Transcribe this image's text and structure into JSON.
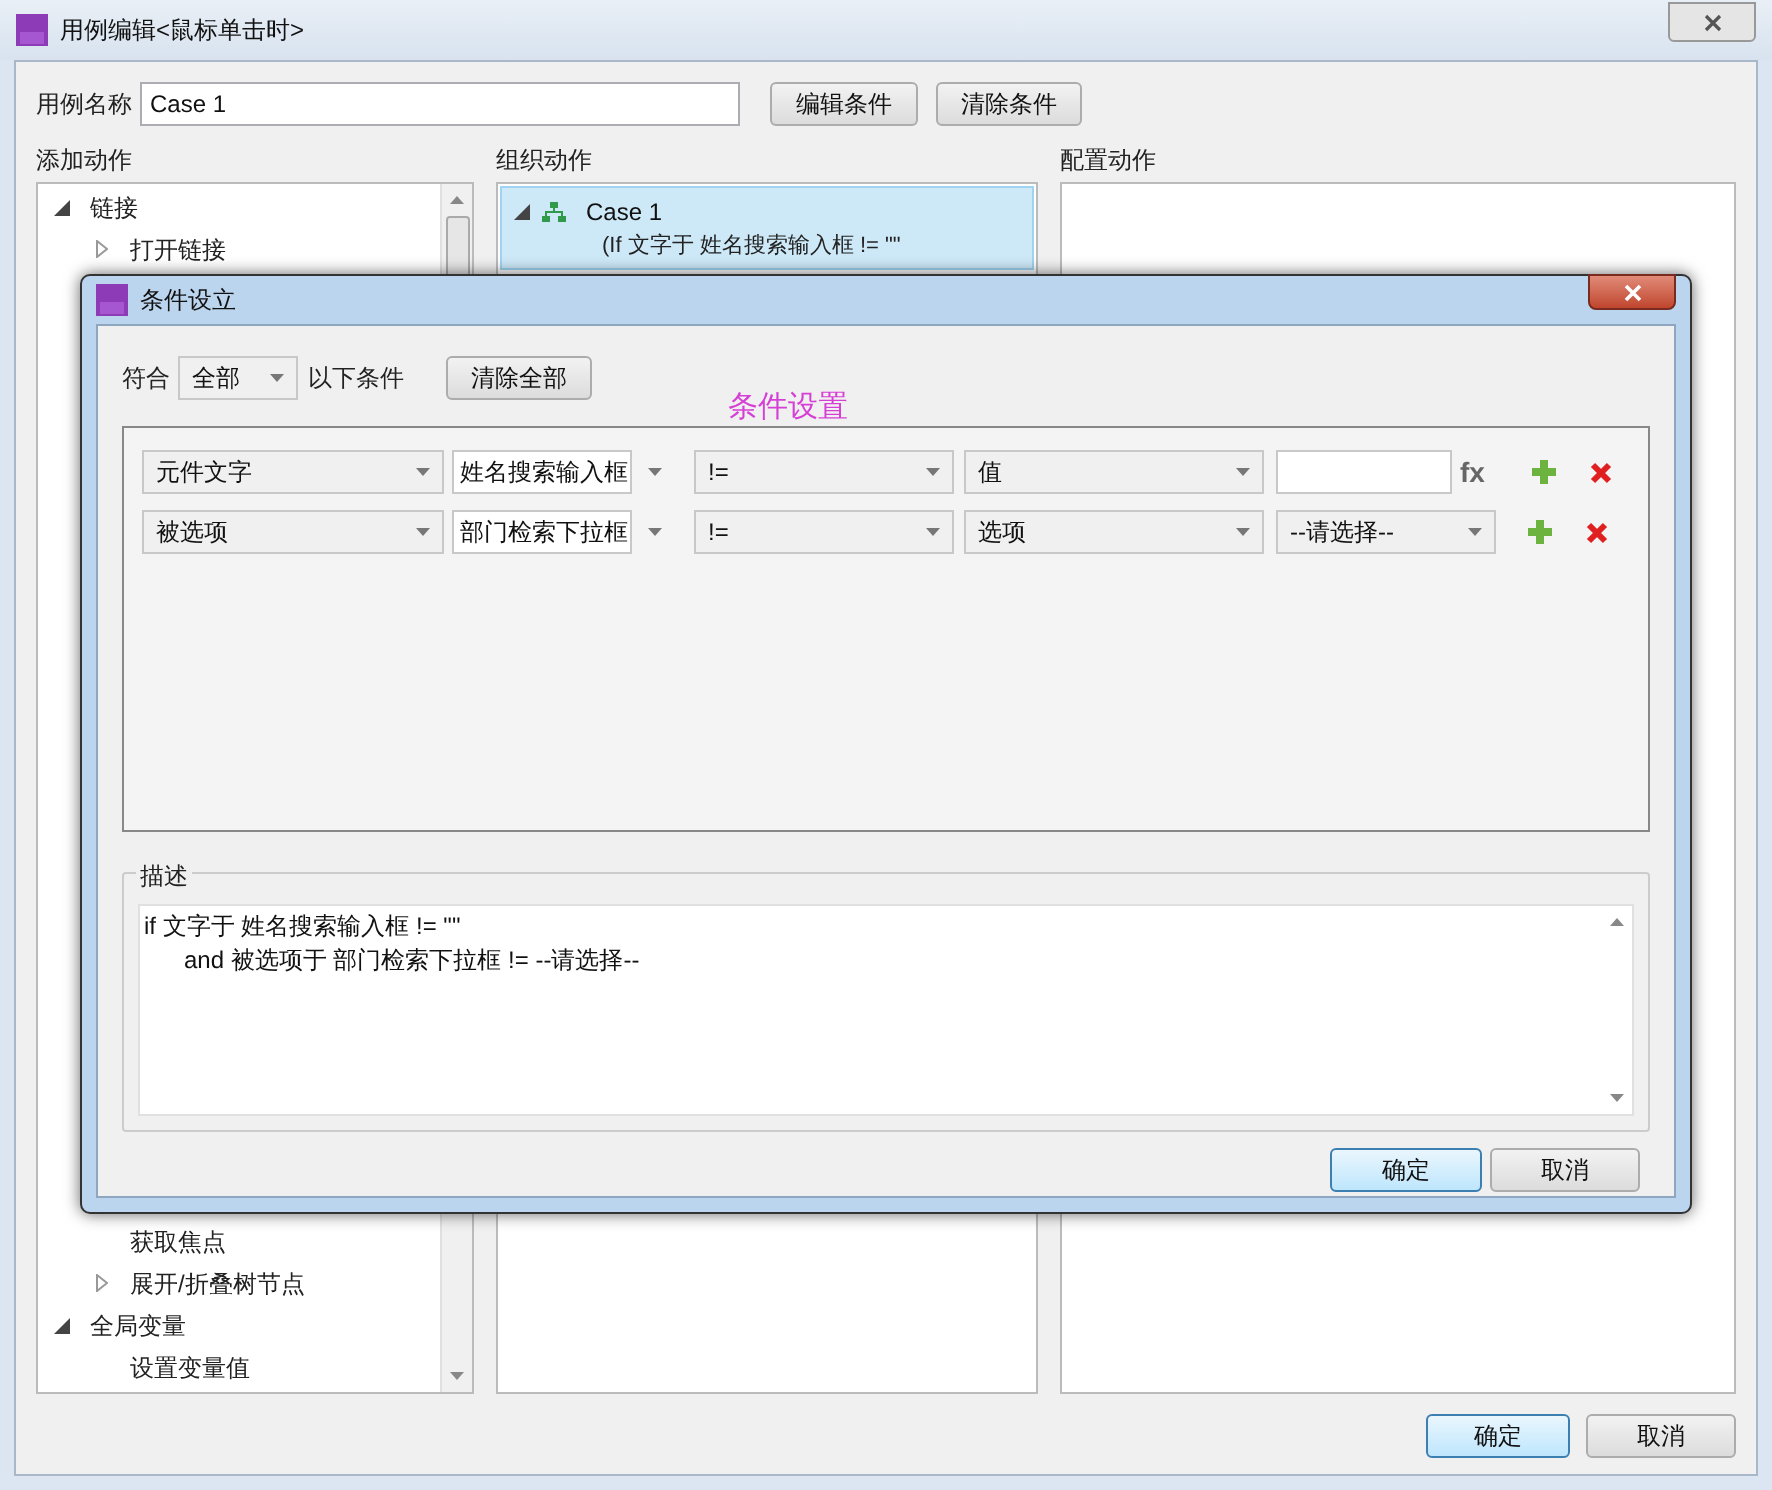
{
  "window": {
    "title": "用例编辑<鼠标单击时>"
  },
  "case_name": {
    "label": "用例名称",
    "value": "Case 1"
  },
  "top_buttons": [
    "编辑条件",
    "清除条件"
  ],
  "add_actions": {
    "title": "添加动作",
    "tree_top": [
      {
        "label": "链接",
        "kind": "node",
        "expanded": true,
        "children": [
          {
            "label": "打开链接",
            "kind": "node",
            "expanded": false
          }
        ]
      }
    ],
    "tree_after_dialog": [
      {
        "label": "获取焦点",
        "kind": "leaf"
      },
      {
        "label": "展开/折叠树节点",
        "kind": "node",
        "expanded": false
      }
    ],
    "tree_groups": [
      {
        "label": "全局变量",
        "kind": "node",
        "expanded": true,
        "children": [
          {
            "label": "设置变量值",
            "kind": "leaf"
          }
        ]
      }
    ]
  },
  "organize_actions": {
    "title": "组织动作",
    "case": {
      "label": "Case 1",
      "expanded": true,
      "selected": true,
      "condition": "(If 文字于 姓名搜索输入框 != \"\""
    }
  },
  "configure_actions": {
    "title": "配置动作"
  },
  "dialog": {
    "title": "条件设立",
    "match_label": "符合",
    "match_value": "全部",
    "match_suffix": "以下条件",
    "clear_all": "清除全部",
    "annotation": "条件设置",
    "conditions": [
      {
        "kind": "text",
        "target_type": "元件文字",
        "widget": "姓名搜索输入框",
        "operator": "!=",
        "value_type": "值",
        "fx": "fx"
      },
      {
        "kind": "select",
        "target_type": "被选项",
        "widget": "部门检索下拉框",
        "operator": "!=",
        "value_type": "选项",
        "value": "--请选择--"
      }
    ],
    "description": {
      "label": "描述",
      "lines": [
        "if 文字于 姓名搜索输入框 != \"\"",
        "and 被选项于 部门检索下拉框 != --请选择--"
      ]
    },
    "buttons": [
      "确定",
      "取消"
    ]
  },
  "bottom_buttons": [
    "确定",
    "取消"
  ]
}
